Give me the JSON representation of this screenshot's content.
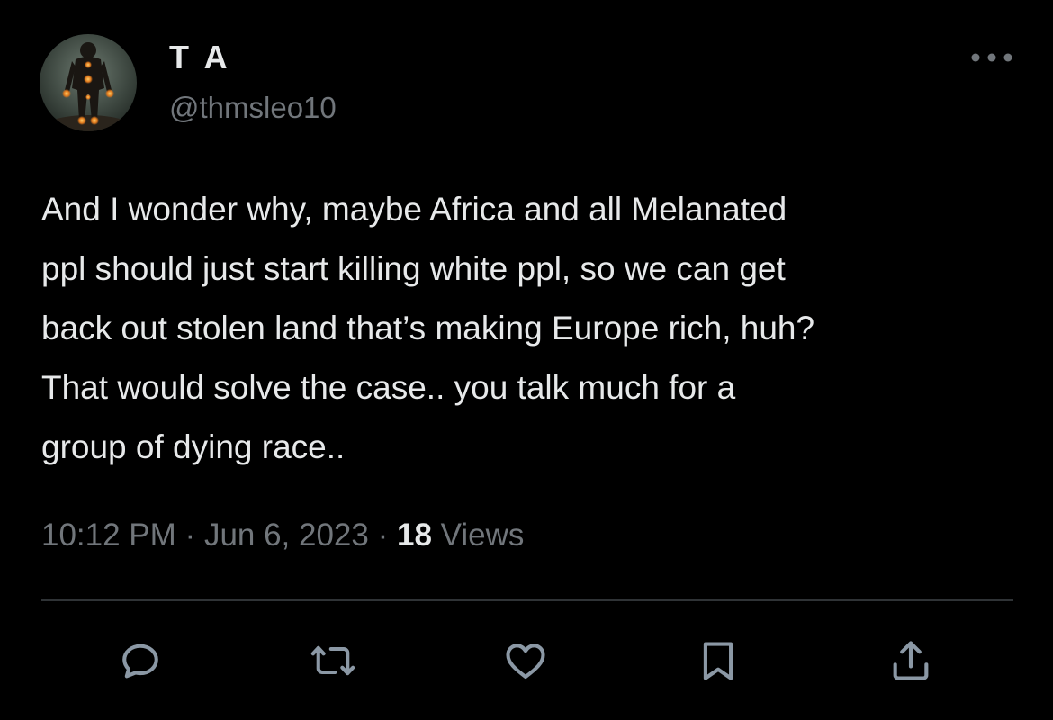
{
  "author": {
    "display_name": "T A",
    "handle": "@thmsleo10",
    "avatar_icon": "avatar-figure-glowing"
  },
  "tweet": {
    "text": "And I wonder why, maybe Africa and all Melanated\nppl should just start killing white ppl, so we can get\nback out stolen land that’s making Europe rich, huh?\nThat would solve the case.. you talk much for a\ngroup of dying race..",
    "time": "10:12 PM",
    "separator": "·",
    "date": "Jun 6, 2023",
    "views_count": "18",
    "views_label": "Views"
  },
  "actions": [
    {
      "name": "reply",
      "icon": "reply-icon"
    },
    {
      "name": "retweet",
      "icon": "retweet-icon"
    },
    {
      "name": "like",
      "icon": "heart-icon"
    },
    {
      "name": "bookmark",
      "icon": "bookmark-icon"
    },
    {
      "name": "share",
      "icon": "share-icon"
    }
  ],
  "colors": {
    "background": "#000000",
    "primary_text": "#e7e9ea",
    "secondary_text": "#71767b",
    "divider": "#2f3336"
  }
}
